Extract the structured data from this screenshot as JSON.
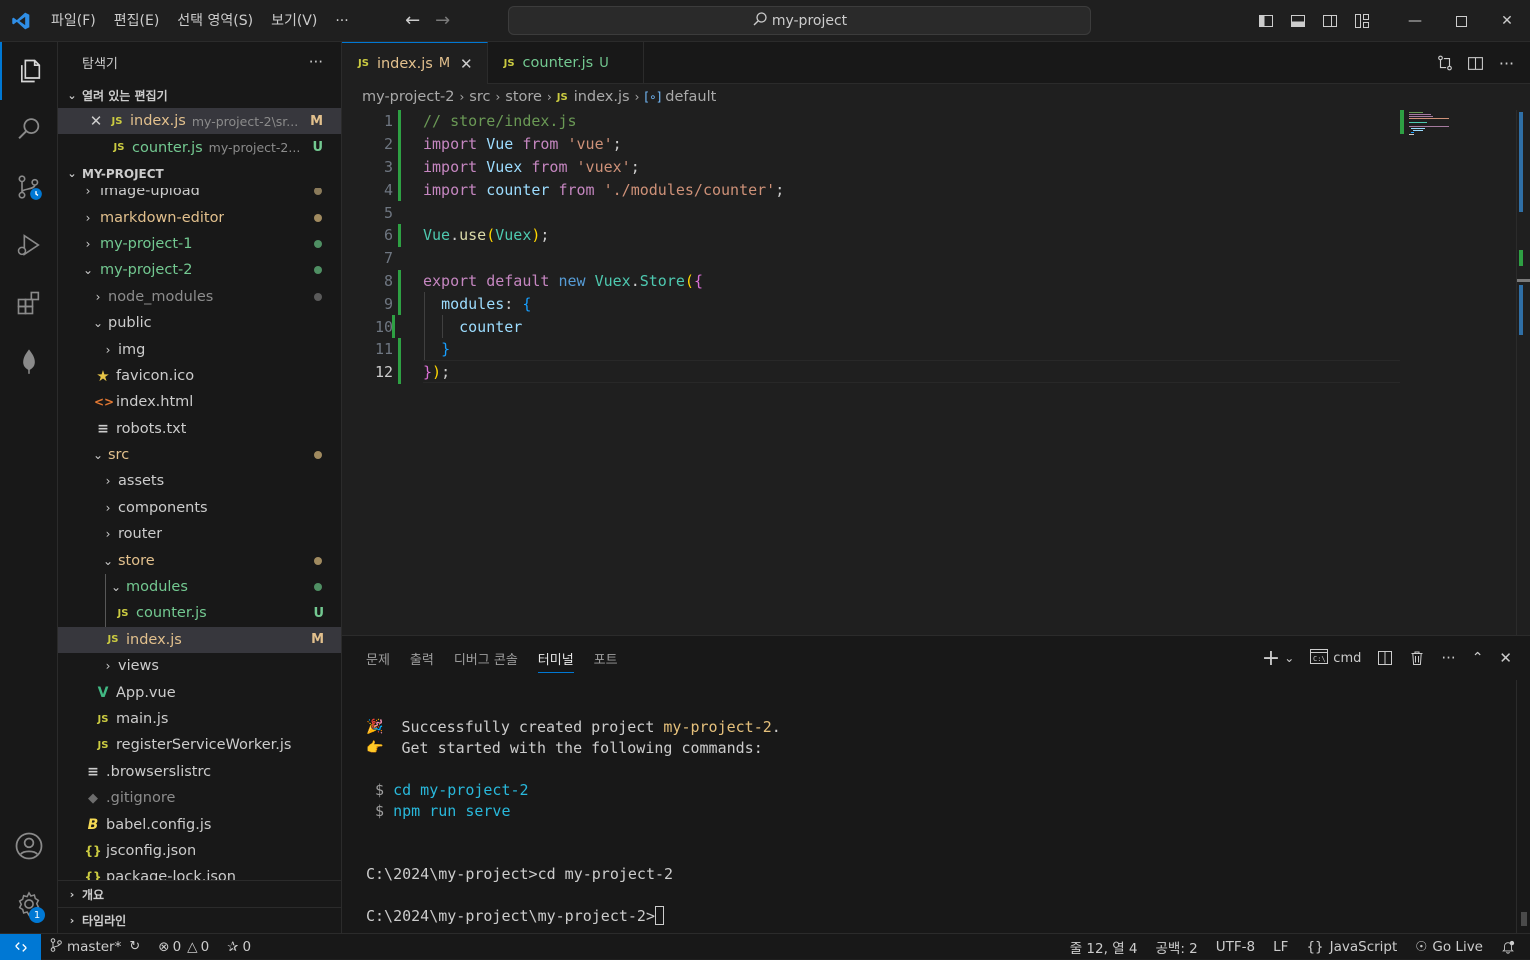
{
  "titlebar": {
    "menus": [
      "파일(F)",
      "편집(E)",
      "선택 영역(S)",
      "보기(V)"
    ],
    "more": "···",
    "search_text": "my-project"
  },
  "sidebar": {
    "title": "탐색기",
    "more": "···",
    "open_editors": {
      "header": "열려 있는 편집기",
      "items": [
        {
          "label": "index.js",
          "desc": "my-project-2\\sr...",
          "status": "M"
        },
        {
          "label": "counter.js",
          "desc": "my-project-2...",
          "status": "U"
        }
      ]
    },
    "project": {
      "header": "MY-PROJECT",
      "rows": [
        {
          "label": "image-upload"
        },
        {
          "label": "markdown-editor"
        },
        {
          "label": "my-project-1"
        },
        {
          "label": "my-project-2"
        },
        {
          "label": "node_modules"
        },
        {
          "label": "public"
        },
        {
          "label": "img"
        },
        {
          "label": "favicon.ico"
        },
        {
          "label": "index.html"
        },
        {
          "label": "robots.txt"
        },
        {
          "label": "src"
        },
        {
          "label": "assets"
        },
        {
          "label": "components"
        },
        {
          "label": "router"
        },
        {
          "label": "store"
        },
        {
          "label": "modules"
        },
        {
          "label": "counter.js",
          "status": "U"
        },
        {
          "label": "index.js",
          "status": "M"
        },
        {
          "label": "views"
        },
        {
          "label": "App.vue"
        },
        {
          "label": "main.js"
        },
        {
          "label": "registerServiceWorker.js"
        },
        {
          "label": ".browserslistrc"
        },
        {
          "label": ".gitignore"
        },
        {
          "label": "babel.config.js"
        },
        {
          "label": "jsconfig.json"
        },
        {
          "label": "package-lock.json"
        }
      ]
    },
    "outline_header": "개요",
    "timeline_header": "타임라인"
  },
  "editor": {
    "tabs": [
      {
        "label": "index.js",
        "mark": "M"
      },
      {
        "label": "counter.js",
        "mark": "U"
      }
    ],
    "breadcrumb": [
      "my-project-2",
      "src",
      "store",
      "index.js",
      "default"
    ],
    "line_numbers": [
      "1",
      "2",
      "3",
      "4",
      "5",
      "6",
      "7",
      "8",
      "9",
      "10",
      "11",
      "12"
    ]
  },
  "panel": {
    "tabs": [
      "문제",
      "출력",
      "디버그 콘솔",
      "터미널",
      "포트"
    ],
    "terminal_name": "cmd",
    "terminal_lines": {
      "l1_emoji": "🎉",
      "l1_text": "Successfully created project ",
      "l1_name": "my-project-2",
      "l1_end": ".",
      "l2_emoji": "👉",
      "l2_text": "Get started with the following commands:",
      "cmd1_prompt": "$",
      "cmd1": "cd my-project-2",
      "cmd2_prompt": "$",
      "cmd2": "npm run serve",
      "p1": "C:\\2024\\my-project>cd my-project-2",
      "p2": "C:\\2024\\my-project\\my-project-2>"
    }
  },
  "statusbar": {
    "branch": "master*",
    "errors": "0",
    "warnings": "0",
    "ports": "0",
    "position": "줄 12, 열 4",
    "spaces": "공백: 2",
    "encoding": "UTF-8",
    "eol": "LF",
    "language": "JavaScript",
    "golive": "Go Live",
    "bell_badge": ""
  },
  "colors": {
    "accent": "#0078d4",
    "modified": "#e2c08d",
    "untracked": "#73c991"
  }
}
